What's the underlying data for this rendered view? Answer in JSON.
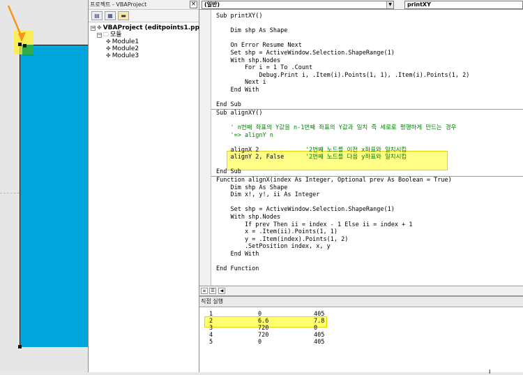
{
  "project": {
    "title": "프로젝트 - VBAProject",
    "close": "×",
    "toolbar_icons": [
      "view-code-icon",
      "view-object-icon",
      "toggle-folders-icon"
    ],
    "tree": [
      {
        "text": "VBAProject (editpoints1.pptm)",
        "level": 0,
        "expander": "⊟",
        "icon": "vba-project-icon"
      },
      {
        "text": "모듈",
        "level": 1,
        "expander": "⊟",
        "icon": "folder-icon"
      },
      {
        "text": "Module1",
        "level": 2,
        "expander": "",
        "icon": "module-icon"
      },
      {
        "text": "Module2",
        "level": 2,
        "expander": "",
        "icon": "module-icon"
      },
      {
        "text": "Module3",
        "level": 2,
        "expander": "",
        "icon": "module-icon"
      }
    ]
  },
  "code": {
    "object_combo": "(일반)",
    "procedure_combo": "printXY",
    "lines": [
      {
        "t": "Sub printXY()",
        "k": "sub"
      },
      {
        "t": "",
        "k": ""
      },
      {
        "t": "    Dim shp As Shape",
        "k": ""
      },
      {
        "t": "",
        "k": ""
      },
      {
        "t": "    On Error Resume Next",
        "k": "kw"
      },
      {
        "t": "    Set shp = ActiveWindow.Selection.ShapeRange(1)",
        "k": ""
      },
      {
        "t": "    With shp.Nodes",
        "k": ""
      },
      {
        "t": "        For i = 1 To .Count",
        "k": ""
      },
      {
        "t": "            Debug.Print i, .Item(i).Points(1, 1), .Item(i).Points(1, 2)",
        "k": ""
      },
      {
        "t": "        Next i",
        "k": ""
      },
      {
        "t": "    End With",
        "k": "kw"
      },
      {
        "t": "",
        "k": ""
      },
      {
        "t": "End Sub",
        "k": "kw"
      },
      {
        "t": "SEP",
        "k": "sep"
      },
      {
        "t": "Sub alignXY()",
        "k": ""
      },
      {
        "t": "",
        "k": ""
      },
      {
        "t": "    ' n번째 좌표의 Y값을 n-1번째 좌표의 Y값과 일치 즉 세로로 평행하게 만드는 경우",
        "k": "cm"
      },
      {
        "t": "    '=> alignY n",
        "k": "cm"
      },
      {
        "t": "",
        "k": ""
      },
      {
        "t": "    alignX 2             '2번째 노드를 이전 x좌표와 일치시킴",
        "k": "mix"
      },
      {
        "t": "    alignY 2, False      '2번째 노드를 다음 y좌표와 일치시킴",
        "k": "mix"
      },
      {
        "t": "",
        "k": ""
      },
      {
        "t": "End Sub",
        "k": "kw"
      },
      {
        "t": "SEP",
        "k": "sep"
      },
      {
        "t": "Function alignX(index As Integer, Optional prev As Boolean = True)",
        "k": ""
      },
      {
        "t": "    Dim shp As Shape",
        "k": ""
      },
      {
        "t": "    Dim x!, y!, ii As Integer",
        "k": ""
      },
      {
        "t": "",
        "k": ""
      },
      {
        "t": "    Set shp = ActiveWindow.Selection.ShapeRange(1)",
        "k": ""
      },
      {
        "t": "    With shp.Nodes",
        "k": ""
      },
      {
        "t": "        If prev Then ii = index - 1 Else ii = index + 1",
        "k": ""
      },
      {
        "t": "        x = .Item(ii).Points(1, 1)",
        "k": ""
      },
      {
        "t": "        y = .Item(index).Points(1, 2)",
        "k": ""
      },
      {
        "t": "        .SetPosition index, x, y",
        "k": ""
      },
      {
        "t": "    End With",
        "k": "kw"
      },
      {
        "t": "",
        "k": ""
      },
      {
        "t": "End Function",
        "k": "kw"
      }
    ]
  },
  "immediate": {
    "title": "직접 실행",
    "rows": [
      {
        "i": "1",
        "x": "0",
        "y": "405"
      },
      {
        "i": "2",
        "x": "6.6",
        "y": "7.8"
      },
      {
        "i": "3",
        "x": "720",
        "y": "0"
      },
      {
        "i": "4",
        "x": "720",
        "y": "405"
      },
      {
        "i": "5",
        "x": "0",
        "y": "405"
      }
    ],
    "highlighted_row": 2,
    "cursor_glyph": "I"
  },
  "colors": {
    "shape_fill": "#00a5dc",
    "highlight": "#ffff70",
    "arrow": "#f7941d",
    "selected_node": "#16a34a",
    "keyword": "#00007f",
    "comment": "#007f00"
  }
}
